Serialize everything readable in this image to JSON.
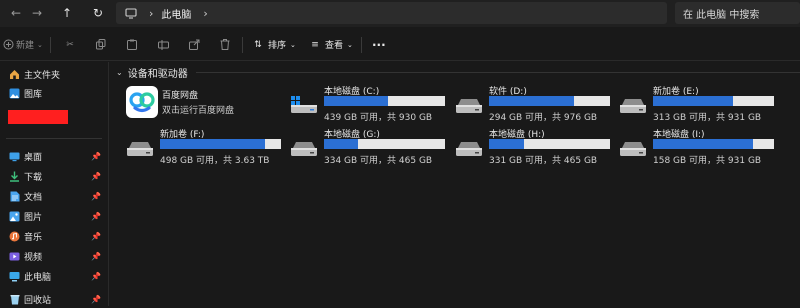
{
  "address": {
    "crumb": "此电脑",
    "search_placeholder": "在 此电脑 中搜索"
  },
  "toolbar": {
    "new_label": "新建",
    "sort_label": "排序",
    "view_label": "查看"
  },
  "sidebar": {
    "items": [
      {
        "label": "主文件夹",
        "icon": "home-icon"
      },
      {
        "label": "图库",
        "icon": "gallery-icon"
      },
      {
        "label": "桌面",
        "icon": "desktop-icon",
        "pinned": true
      },
      {
        "label": "下载",
        "icon": "download-icon",
        "pinned": true
      },
      {
        "label": "文档",
        "icon": "documents-icon",
        "pinned": true
      },
      {
        "label": "图片",
        "icon": "pictures-icon",
        "pinned": true
      },
      {
        "label": "音乐",
        "icon": "music-icon",
        "pinned": true
      },
      {
        "label": "视频",
        "icon": "videos-icon",
        "pinned": true
      },
      {
        "label": "此电脑",
        "icon": "this-pc-icon",
        "pinned": true
      },
      {
        "label": "回收站",
        "icon": "recycle-bin-icon",
        "pinned": true
      }
    ]
  },
  "main": {
    "group_label": "设备和驱动器",
    "app": {
      "name": "百度网盘",
      "subtitle": "双击运行百度网盘"
    },
    "drives": [
      {
        "name": "本地磁盘 (C:)",
        "info": "439 GB 可用，共 930 GB",
        "used_fraction": 0.53,
        "system": true
      },
      {
        "name": "软件 (D:)",
        "info": "294 GB 可用，共 976 GB",
        "used_fraction": 0.7
      },
      {
        "name": "新加卷 (E:)",
        "info": "313 GB 可用，共 931 GB",
        "used_fraction": 0.66
      },
      {
        "name": "新加卷 (F:)",
        "info": "498 GB 可用，共 3.63 TB",
        "used_fraction": 0.87
      },
      {
        "name": "本地磁盘 (G:)",
        "info": "334 GB 可用，共 465 GB",
        "used_fraction": 0.28
      },
      {
        "name": "本地磁盘 (H:)",
        "info": "331 GB 可用，共 465 GB",
        "used_fraction": 0.29
      },
      {
        "name": "本地磁盘 (I:)",
        "info": "158 GB 可用，共 931 GB",
        "used_fraction": 0.83
      }
    ]
  },
  "colors": {
    "bar_fill": "#2b6fd3",
    "bar_track": "#e6e6e6",
    "background": "#191919",
    "redaction": "#ff1f1f"
  }
}
